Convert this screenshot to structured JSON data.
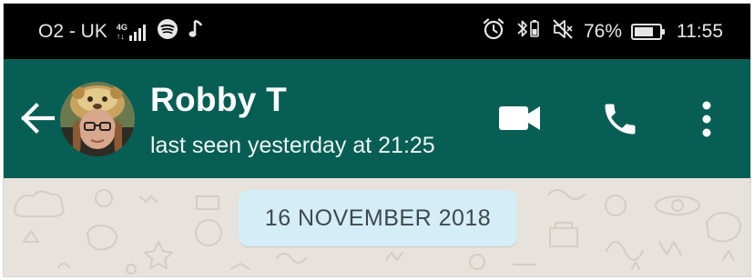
{
  "status_bar": {
    "carrier": "O2 - UK",
    "network_top": "4G",
    "network_bottom": "↑↓",
    "battery_percent": "76%",
    "battery_level": 0.76,
    "time": "11:55"
  },
  "header": {
    "contact_name": "Robby T",
    "contact_status": "last seen yesterday at 21:25",
    "background_color": "#075e54",
    "icons": [
      "back-arrow-icon",
      "video-call-icon",
      "phone-call-icon",
      "more-options-icon"
    ]
  },
  "chat": {
    "date_label": "16 NOVEMBER 2018",
    "background_color": "#e7e2dc",
    "date_pill_color": "#d5edf6"
  }
}
